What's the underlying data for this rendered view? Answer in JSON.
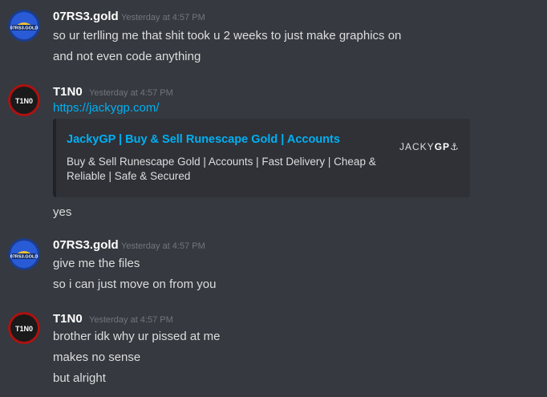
{
  "messages": [
    {
      "author": "07RS3.gold",
      "timestamp": "Yesterday at 4:57 PM",
      "avatar_text": "07RS3.GOLD",
      "lines": [
        "so ur terlling me that shit took u 2 weeks to just make graphics on",
        "and not even code anything"
      ]
    },
    {
      "author": "T1N0",
      "timestamp": "Yesterday at 4:57 PM",
      "avatar_text": "T1N0",
      "link": "https://jackygp.com/",
      "embed": {
        "title": "JackyGP | Buy & Sell Runescape Gold | Accounts",
        "description": "Buy & Sell Runescape Gold | Accounts | Fast Delivery | Cheap & Reliable | Safe & Secured",
        "logo_prefix": "JACKY",
        "logo_suffix": "GP",
        "logo_icon": "anchor-icon"
      },
      "lines": [
        "yes"
      ]
    },
    {
      "author": "07RS3.gold",
      "timestamp": "Yesterday at 4:57 PM",
      "avatar_text": "07RS3.GOLD",
      "lines": [
        "give me the files",
        "so i can just move on from you"
      ]
    },
    {
      "author": "T1N0",
      "timestamp": "Yesterday at 4:57 PM",
      "avatar_text": "T1N0",
      "lines": [
        "brother idk why ur pissed at me",
        "makes no sense",
        "but alright"
      ]
    }
  ],
  "colors": {
    "background": "#36393f",
    "link": "#00b0f4",
    "embed_bg": "#2f3136"
  }
}
